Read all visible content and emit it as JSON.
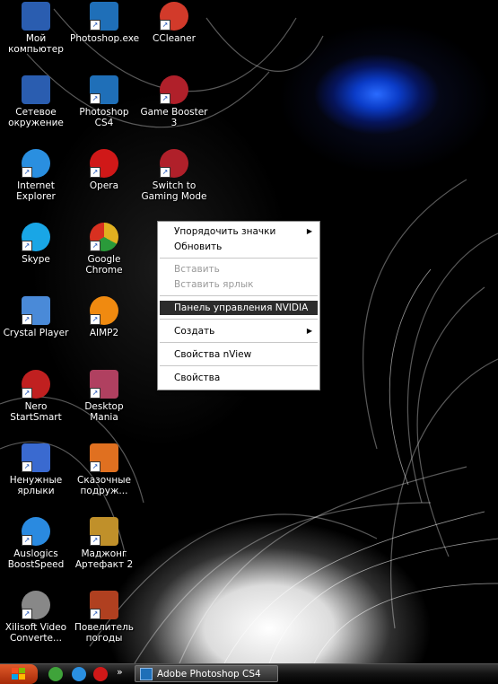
{
  "desktop_icons": [
    {
      "label": "Мой компьютер",
      "icon": "my-computer-icon",
      "color": "#2a5db0"
    },
    {
      "label": "Photoshop.exe",
      "icon": "photoshop-icon",
      "color": "#1f6fb8"
    },
    {
      "label": "CCleaner",
      "icon": "ccleaner-icon",
      "color": "#d23a2a"
    },
    {
      "label": "Сетевое окружение",
      "icon": "network-places-icon",
      "color": "#2a5db0"
    },
    {
      "label": "Photoshop CS4",
      "icon": "photoshop-icon",
      "color": "#1f6fb8"
    },
    {
      "label": "Game Booster 3",
      "icon": "game-booster-icon",
      "color": "#b0202a"
    },
    {
      "label": "Internet Explorer",
      "icon": "internet-explorer-icon",
      "color": "#2a8fe0"
    },
    {
      "label": "Opera",
      "icon": "opera-icon",
      "color": "#d01818"
    },
    {
      "label": "Switch to Gaming Mode",
      "icon": "game-booster-icon",
      "color": "#b0202a"
    },
    {
      "label": "Skype",
      "icon": "skype-icon",
      "color": "#19a6e6"
    },
    {
      "label": "Google Chrome",
      "icon": "google-chrome-icon",
      "color": "#e0b020"
    },
    {
      "label": "Crystal Player",
      "icon": "crystal-player-icon",
      "color": "#4a8ad8"
    },
    {
      "label": "AIMP2",
      "icon": "aimp-icon",
      "color": "#f08a10"
    },
    {
      "label": "Nero StartSmart",
      "icon": "nero-icon",
      "color": "#c02020"
    },
    {
      "label": "Desktop Mania",
      "icon": "desktop-mania-icon",
      "color": "#b04060"
    },
    {
      "label": "Ненужные ярлыки",
      "icon": "folder-icon",
      "color": "#3a6ad0"
    },
    {
      "label": "Сказочные подруж...",
      "icon": "game-icon",
      "color": "#e07020"
    },
    {
      "label": "Auslogics BoostSpeed",
      "icon": "auslogics-icon",
      "color": "#2a8ae0"
    },
    {
      "label": "Маджонг Артефакт 2",
      "icon": "mahjong-icon",
      "color": "#c0902a"
    },
    {
      "label": "Xilisoft Video Converte...",
      "icon": "xilisoft-icon",
      "color": "#888888"
    },
    {
      "label": "Повелитель погоды",
      "icon": "weather-game-icon",
      "color": "#b04020"
    }
  ],
  "context_menu": {
    "items": [
      {
        "label": "Упорядочить значки",
        "submenu": "▶"
      },
      {
        "label": "Обновить"
      },
      {
        "label": "Вставить"
      },
      {
        "label": "Вставить ярлык"
      },
      {
        "label": "Панель управления NVIDIA"
      },
      {
        "label": "Создать",
        "submenu": "▶"
      },
      {
        "label": "Свойства nView"
      },
      {
        "label": "Свойства"
      }
    ]
  },
  "taskbar": {
    "start_icon": "windows-logo-icon",
    "quick_launch": [
      "utorrent-icon",
      "ie-icon",
      "opera-icon"
    ],
    "chevron": "»",
    "task_label": "Adobe Photoshop CS4"
  }
}
